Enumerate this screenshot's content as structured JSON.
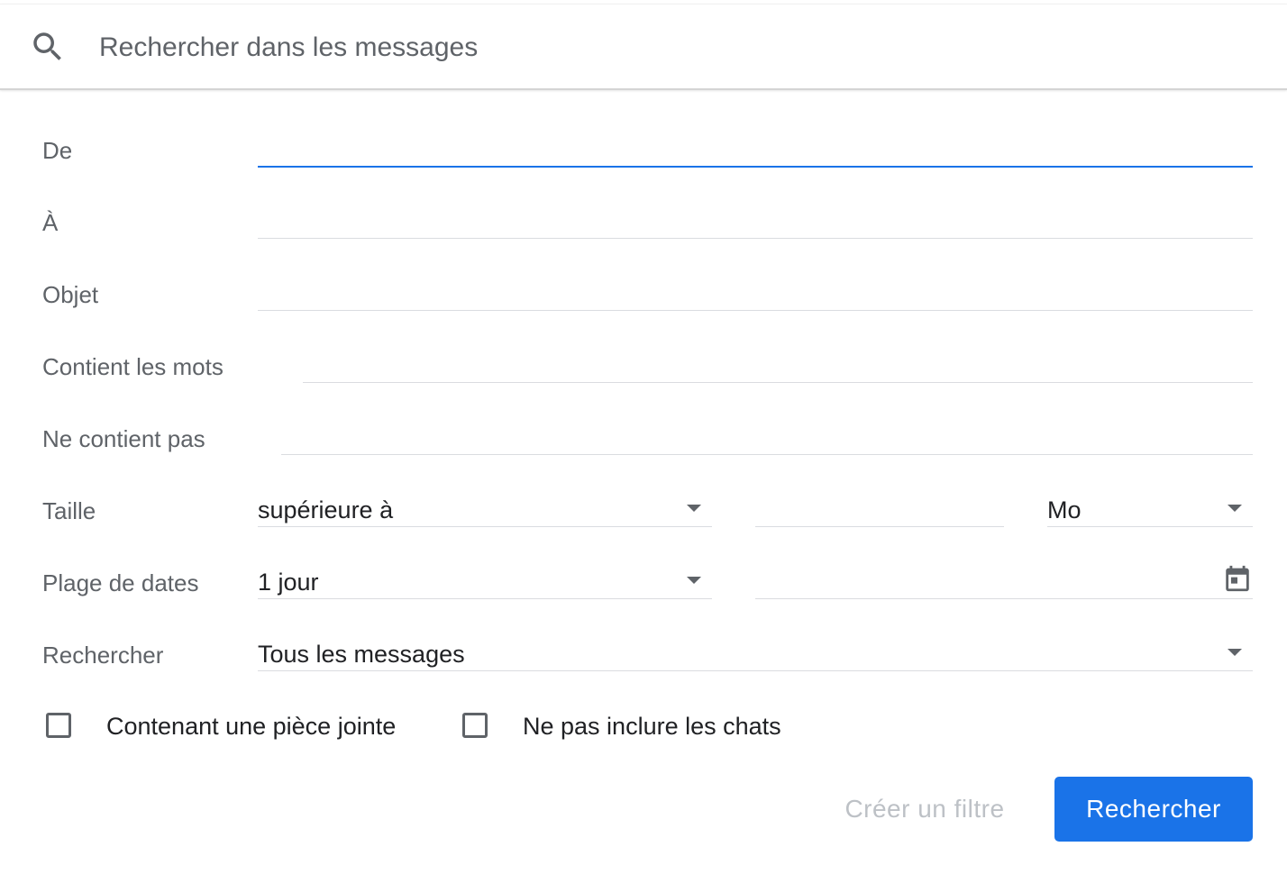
{
  "search": {
    "placeholder": "Rechercher dans les messages",
    "value": ""
  },
  "fields": {
    "from": {
      "label": "De",
      "value": ""
    },
    "to": {
      "label": "À",
      "value": ""
    },
    "subject": {
      "label": "Objet",
      "value": ""
    },
    "has_words": {
      "label": "Contient les mots",
      "value": ""
    },
    "not_words": {
      "label": "Ne contient pas",
      "value": ""
    }
  },
  "size": {
    "label": "Taille",
    "operator": "supérieure à",
    "amount": "",
    "unit": "Mo"
  },
  "date_range": {
    "label": "Plage de dates",
    "range": "1 jour",
    "date": ""
  },
  "search_in": {
    "label": "Rechercher",
    "value": "Tous les messages"
  },
  "checkboxes": {
    "has_attachment": {
      "label": "Contenant une pièce jointe",
      "checked": false
    },
    "exclude_chats": {
      "label": "Ne pas inclure les chats",
      "checked": false
    }
  },
  "buttons": {
    "create_filter": "Créer un filtre",
    "search": "Rechercher"
  },
  "colors": {
    "accent": "#1a73e8",
    "label": "#5f6368",
    "text": "#202124",
    "disabled": "#bdc1c6"
  },
  "icons": {
    "search": "search-icon",
    "calendar": "calendar-icon",
    "dropdown": "dropdown-arrow-icon"
  }
}
